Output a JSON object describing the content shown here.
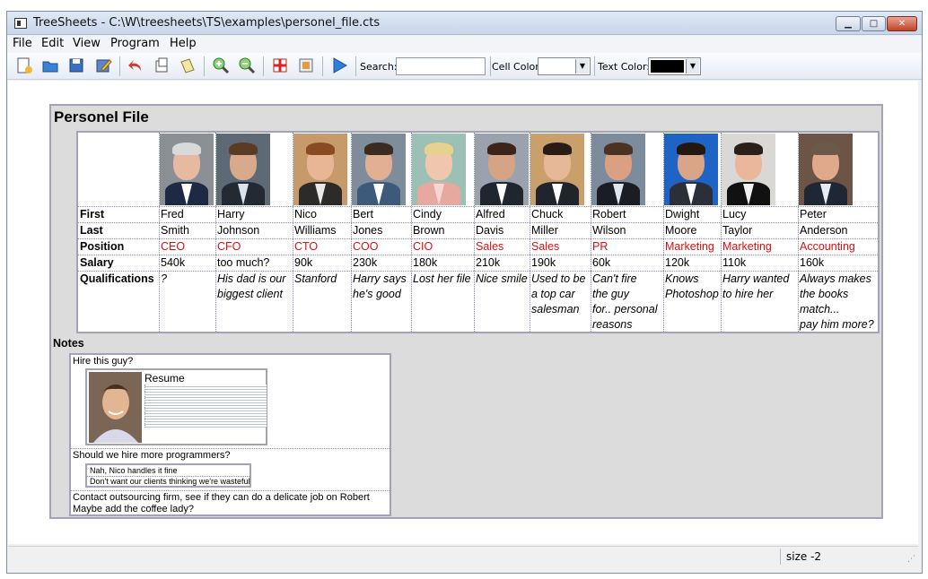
{
  "window": {
    "title": "TreeSheets - C:\\W\\treesheets\\TS\\examples\\personel_file.cts",
    "controls": {
      "minimize": "▁",
      "maximize": "□",
      "close": "✕"
    }
  },
  "menu": {
    "file": "File",
    "edit": "Edit",
    "view": "View",
    "program": "Program",
    "help": "Help"
  },
  "toolbar": {
    "search_label": "Search:",
    "search_value": "",
    "cell_color_label": "Cell Color:",
    "cell_color_value": "#ffffff",
    "text_color_label": "Text Color:",
    "text_color_value": "#000000",
    "icons": [
      "new-icon",
      "open-icon",
      "save-icon",
      "edit-icon",
      "undo-icon",
      "copy-icon",
      "paste-icon",
      "zoom-in-icon",
      "zoom-out-icon",
      "image-icon",
      "image-alt-icon",
      "run-icon"
    ]
  },
  "document": {
    "title": "Personel File",
    "row_labels": {
      "first": "First",
      "last": "Last",
      "position": "Position",
      "salary": "Salary",
      "qualifications": "Qualifications"
    },
    "people": [
      {
        "first": "Fred",
        "last": "Smith",
        "position": "CEO",
        "salary": "540k",
        "qual": [
          "?"
        ]
      },
      {
        "first": "Harry",
        "last": "Johnson",
        "position": "CFO",
        "salary": "too much?",
        "qual": [
          "His dad is our",
          "biggest client"
        ]
      },
      {
        "first": "Nico",
        "last": "Williams",
        "position": "CTO",
        "salary": "90k",
        "qual": [
          "Stanford"
        ]
      },
      {
        "first": "Bert",
        "last": "Jones",
        "position": "COO",
        "salary": "230k",
        "qual": [
          "Harry says",
          "he's good"
        ]
      },
      {
        "first": "Cindy",
        "last": "Brown",
        "position": "CIO",
        "salary": "180k",
        "qual": [
          "Lost her file"
        ]
      },
      {
        "first": "Alfred",
        "last": "Davis",
        "position": "Sales",
        "salary": "210k",
        "qual": [
          "Nice smile"
        ]
      },
      {
        "first": "Chuck",
        "last": "Miller",
        "position": "Sales",
        "salary": "190k",
        "qual": [
          "Used to be",
          "a top car",
          "salesman"
        ]
      },
      {
        "first": "Robert",
        "last": "Wilson",
        "position": "PR",
        "salary": "60k",
        "qual": [
          "Can't fire",
          "the guy",
          "for.. personal",
          "reasons"
        ]
      },
      {
        "first": "Dwight",
        "last": "Moore",
        "position": "Marketing",
        "salary": "120k",
        "qual": [
          "Knows",
          "Photoshop"
        ]
      },
      {
        "first": "Lucy",
        "last": "Taylor",
        "position": "Marketing",
        "salary": "110k",
        "qual": [
          "Harry wanted",
          "to hire her"
        ]
      },
      {
        "first": "Peter",
        "last": "Anderson",
        "position": "Accounting",
        "salary": "160k",
        "qual": [
          "Always makes",
          "the books",
          "match...",
          "pay him more?"
        ]
      }
    ],
    "position_color": "#d81010",
    "notes": {
      "label": "Notes",
      "hire_question": "Hire this guy?",
      "resume_label": "Resume",
      "programmers_question": "Should we hire more programmers?",
      "answers": [
        "Nah, Nico handles it fine",
        "Don't want our clients thinking we're wasteful"
      ],
      "outsourcing": "Contact outsourcing firm, see if they can do a delicate job on Robert",
      "coffee": "Maybe add the coffee lady?"
    }
  },
  "status": {
    "text": "size -2"
  }
}
